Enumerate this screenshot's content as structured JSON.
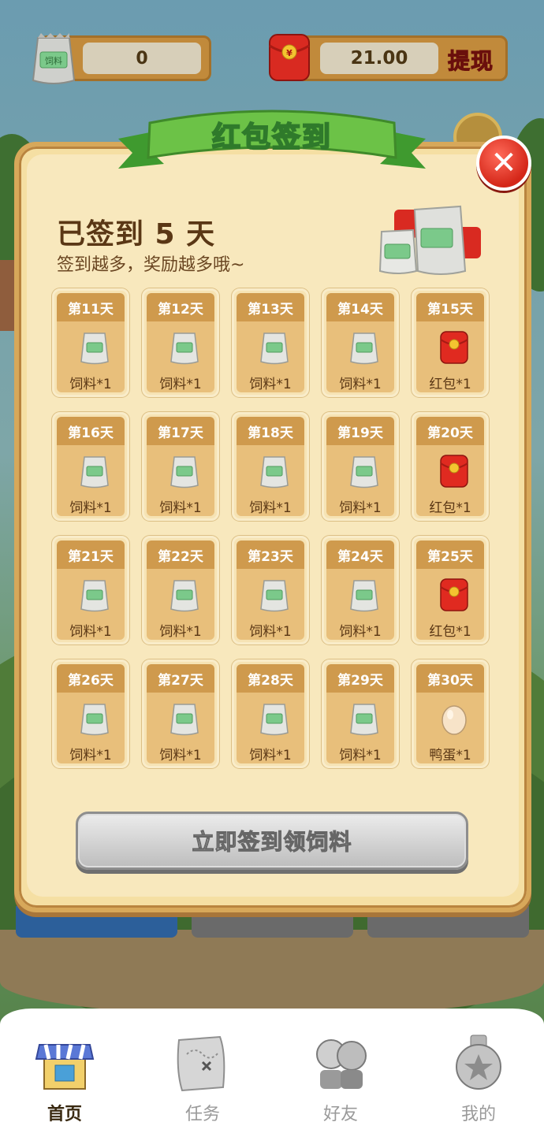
{
  "top_bar": {
    "feed_count": "0",
    "money_amount": "21.00",
    "withdraw_label": "提现",
    "feed_icon_text": "饲料",
    "envelope_symbol": "¥"
  },
  "modal": {
    "ribbon_title": "红包签到",
    "close_symbol": "✕",
    "signed_title": "已签到 5 天",
    "signed_subtitle": "签到越多，奖励越多哦~",
    "sign_button_label": "立即签到领饲料"
  },
  "days": [
    {
      "day": "第11天",
      "reward": "饲料*1",
      "type": "feed"
    },
    {
      "day": "第12天",
      "reward": "饲料*1",
      "type": "feed"
    },
    {
      "day": "第13天",
      "reward": "饲料*1",
      "type": "feed"
    },
    {
      "day": "第14天",
      "reward": "饲料*1",
      "type": "feed"
    },
    {
      "day": "第15天",
      "reward": "红包*1",
      "type": "envelope"
    },
    {
      "day": "第16天",
      "reward": "饲料*1",
      "type": "feed"
    },
    {
      "day": "第17天",
      "reward": "饲料*1",
      "type": "feed"
    },
    {
      "day": "第18天",
      "reward": "饲料*1",
      "type": "feed"
    },
    {
      "day": "第19天",
      "reward": "饲料*1",
      "type": "feed"
    },
    {
      "day": "第20天",
      "reward": "红包*1",
      "type": "envelope"
    },
    {
      "day": "第21天",
      "reward": "饲料*1",
      "type": "feed"
    },
    {
      "day": "第22天",
      "reward": "饲料*1",
      "type": "feed"
    },
    {
      "day": "第23天",
      "reward": "饲料*1",
      "type": "feed"
    },
    {
      "day": "第24天",
      "reward": "饲料*1",
      "type": "feed"
    },
    {
      "day": "第25天",
      "reward": "红包*1",
      "type": "envelope"
    },
    {
      "day": "第26天",
      "reward": "饲料*1",
      "type": "feed"
    },
    {
      "day": "第27天",
      "reward": "饲料*1",
      "type": "feed"
    },
    {
      "day": "第28天",
      "reward": "饲料*1",
      "type": "feed"
    },
    {
      "day": "第29天",
      "reward": "饲料*1",
      "type": "feed"
    },
    {
      "day": "第30天",
      "reward": "鸭蛋*1",
      "type": "egg"
    }
  ],
  "tabs": [
    {
      "label": "首页",
      "icon": "shop-icon",
      "active": true
    },
    {
      "label": "任务",
      "icon": "map-scroll-icon",
      "active": false
    },
    {
      "label": "好友",
      "icon": "friends-icon",
      "active": false
    },
    {
      "label": "我的",
      "icon": "medal-icon",
      "active": false
    }
  ],
  "colors": {
    "card_header": "#cf9a4d",
    "card_body": "#e8bf7b",
    "modal_bg": "#f8e8bd",
    "ribbon_green": "#5fb53c",
    "close_red": "#d42618"
  }
}
